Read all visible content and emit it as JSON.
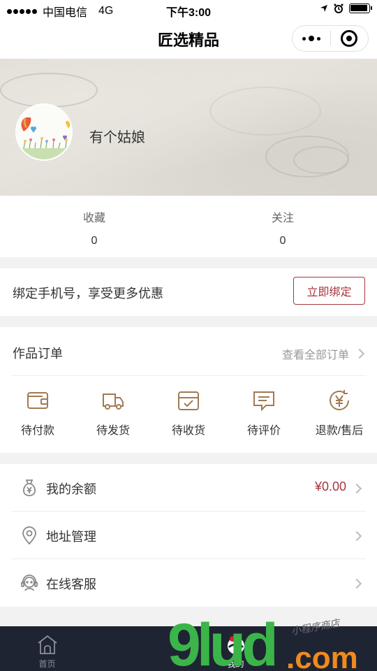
{
  "status_bar": {
    "carrier": "中国电信",
    "network": "4G",
    "time": "下午3:00"
  },
  "nav": {
    "title": "匠选精品"
  },
  "profile": {
    "username": "有个姑娘"
  },
  "stats": [
    {
      "label": "收藏",
      "value": "0"
    },
    {
      "label": "关注",
      "value": "0"
    }
  ],
  "bind_phone": {
    "text": "绑定手机号，享受更多优惠",
    "button": "立即绑定"
  },
  "orders": {
    "title": "作品订单",
    "view_all": "查看全部订单",
    "items": [
      {
        "label": "待付款",
        "icon": "wallet-icon"
      },
      {
        "label": "待发货",
        "icon": "truck-icon"
      },
      {
        "label": "待收货",
        "icon": "box-icon"
      },
      {
        "label": "待评价",
        "icon": "comment-icon"
      },
      {
        "label": "退款/售后",
        "icon": "yen-refund-icon"
      }
    ]
  },
  "menu": [
    {
      "label": "我的余额",
      "value": "¥0.00",
      "icon": "money-bag-icon"
    },
    {
      "label": "地址管理",
      "value": "",
      "icon": "location-pin-icon"
    },
    {
      "label": "在线客服",
      "value": "",
      "icon": "headset-icon"
    }
  ],
  "tab_bar": [
    {
      "label": "首页",
      "icon": "home-icon"
    },
    {
      "label": "我的",
      "icon": "profile-icon"
    }
  ],
  "watermark": {
    "text": "9lud.com",
    "subtext": "小程序商店"
  },
  "colors": {
    "accent": "#a8343c",
    "icon_brown": "#a07a52",
    "tab_bar_bg": "#1f2433",
    "watermark_green": "#3bb54a",
    "watermark_orange": "#f08a1e"
  }
}
